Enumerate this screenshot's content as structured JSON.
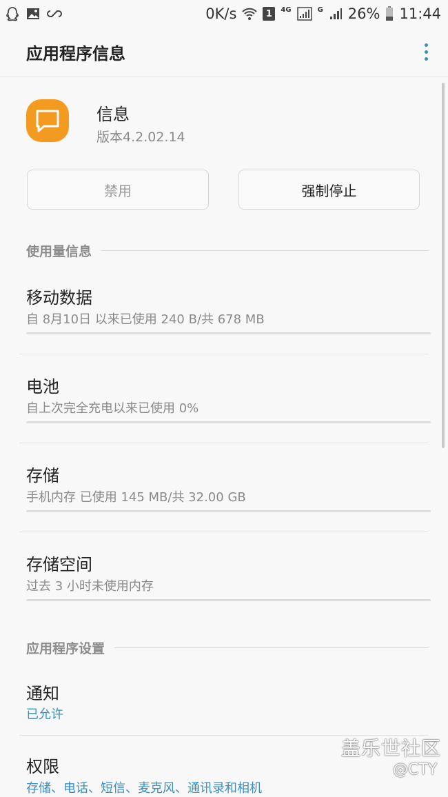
{
  "status_bar": {
    "net_speed": "0K/s",
    "sim_label": "1",
    "net_4g": "4G",
    "net_g": "G",
    "battery": "26%",
    "time": "11:44"
  },
  "app_bar": {
    "title": "应用程序信息"
  },
  "app": {
    "name": "信息",
    "version": "版本4.2.02.14",
    "icon_color": "#f39a21"
  },
  "buttons": {
    "disable": "禁用",
    "force_stop": "强制停止"
  },
  "sections": {
    "usage": {
      "header": "使用量信息",
      "items": [
        {
          "title": "移动数据",
          "subtitle": "自 8月10日 以来已使用 240 B/共 678 MB"
        },
        {
          "title": "电池",
          "subtitle": "自上次完全充电以来已使用 0%"
        },
        {
          "title": "存储",
          "subtitle": "手机内存 已使用 145 MB/共 32.00 GB"
        },
        {
          "title": "存储空间",
          "subtitle": "过去 3 小时未使用内存"
        }
      ]
    },
    "settings": {
      "header": "应用程序设置",
      "items": [
        {
          "title": "通知",
          "subtitle": "已允许"
        },
        {
          "title": "权限",
          "subtitle": "存储、电话、短信、麦克风、通讯录和相机"
        }
      ]
    }
  },
  "watermark": {
    "line1": "盖乐世社区",
    "line2": "@CTY"
  },
  "colors": {
    "accent": "#3a8fc0",
    "background": "#f8f8f8"
  }
}
